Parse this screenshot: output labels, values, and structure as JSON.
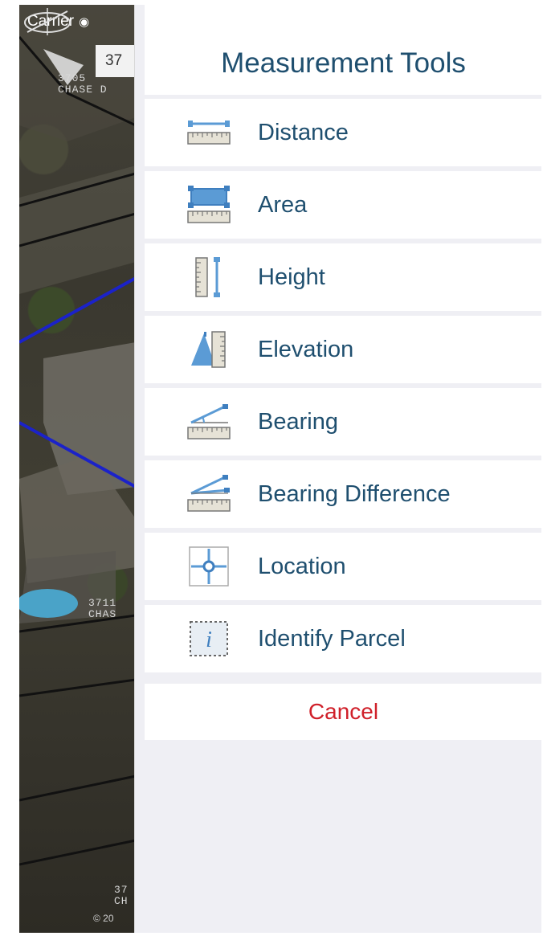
{
  "status_bar": {
    "carrier": "Carrier",
    "wifi_icon": "wifi-icon"
  },
  "map": {
    "callout_text": "37",
    "labels": [
      {
        "text": "3705\nCHASE D"
      },
      {
        "text": "3711\nCHAS"
      },
      {
        "text": "37\nCH"
      }
    ],
    "copyright": "© 20",
    "compass_icon": "compass-icon"
  },
  "sheet": {
    "title": "Measurement Tools",
    "items": [
      {
        "label": "Distance",
        "icon": "ruler-distance-icon"
      },
      {
        "label": "Area",
        "icon": "ruler-area-icon"
      },
      {
        "label": "Height",
        "icon": "ruler-height-icon"
      },
      {
        "label": "Elevation",
        "icon": "ruler-elevation-icon"
      },
      {
        "label": "Bearing",
        "icon": "ruler-bearing-icon"
      },
      {
        "label": "Bearing Difference",
        "icon": "ruler-bearing-difference-icon"
      },
      {
        "label": "Location",
        "icon": "crosshair-location-icon"
      },
      {
        "label": "Identify Parcel",
        "icon": "info-parcel-icon"
      }
    ],
    "cancel_label": "Cancel"
  },
  "colors": {
    "accent_text": "#1f4f6f",
    "cancel_text": "#d0202a",
    "icon_blue": "#5b9bd5",
    "sheet_background": "#efeff4"
  }
}
